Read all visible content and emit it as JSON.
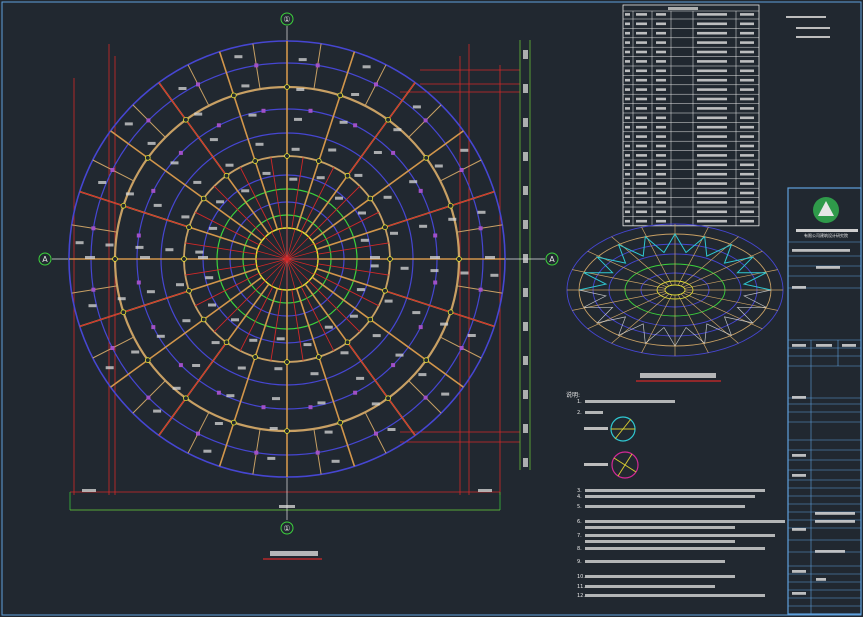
{
  "plan": {
    "axis_top": "①",
    "axis_bottom": "①",
    "axis_left": "A",
    "axis_right": "A",
    "caption": "",
    "scale": ""
  },
  "table": {
    "title": "",
    "rows": 22
  },
  "iso": {
    "caption": ""
  },
  "notes": {
    "heading": "说明:",
    "items": [
      "1.",
      "2.",
      "3.",
      "4.",
      "5.",
      "6.",
      "7.",
      "8.",
      "9.",
      "10.",
      "11.",
      "12."
    ]
  },
  "titleblock": {
    "org": "有限公司建筑设计研究院"
  },
  "colors": {
    "bg": "#212830",
    "ring_blue": "#4646d2",
    "radial_orange": "#d2964b",
    "ring_tan": "#c8a064",
    "green": "#3cd23c",
    "red": "#d22828",
    "white": "#e6e6e6",
    "yellow": "#e6e632",
    "logo_green": "#2f9a4a"
  }
}
